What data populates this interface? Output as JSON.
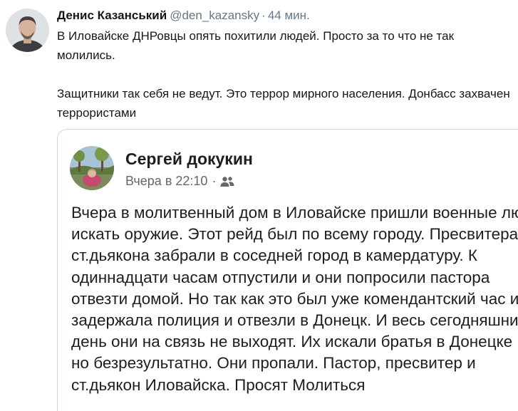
{
  "tweet": {
    "author_name": "Денис Казанський",
    "handle": "@den_kazansky",
    "separator": "·",
    "time": "44 мин.",
    "text_paragraph_1": "В Иловайске ДНРовцы опять похитили людей. Просто за то что не так молились.",
    "text_paragraph_2": "Защитники так себя не ведут. Это террор мирного населения. Донбасс захвачен террористами"
  },
  "embedded_post": {
    "author_name": "Сергей докукин",
    "timestamp": "Вчера в 22:10",
    "separator": "·",
    "audience_icon": "friends-icon",
    "menu_icon": "more-options-icon",
    "body": "Вчера в молитвенный дом в Иловайске пришли военные люди искать оружие. Этот рейд был по всему городу. Пресвитера и ст.дьякона забрали в соседней город в камердатуру. К одиннадцати часам отпустили и они попросили пастора отвезти домой. Но так как это был уже комендантский час их задержала полиция и отвезли в Донецк. И весь сегодняшний день они на связь не выходят. Их искали братья в Донецке , но безрезультатно. Они пропали. Пастор, пресвитер и ст.дьякон Иловайска. Просят Молиться"
  },
  "colors": {
    "text_primary": "#14171a",
    "text_secondary": "#657786",
    "fb_text": "#1c1e21",
    "fb_meta": "#65676b",
    "card_border": "#ccd6dd"
  }
}
